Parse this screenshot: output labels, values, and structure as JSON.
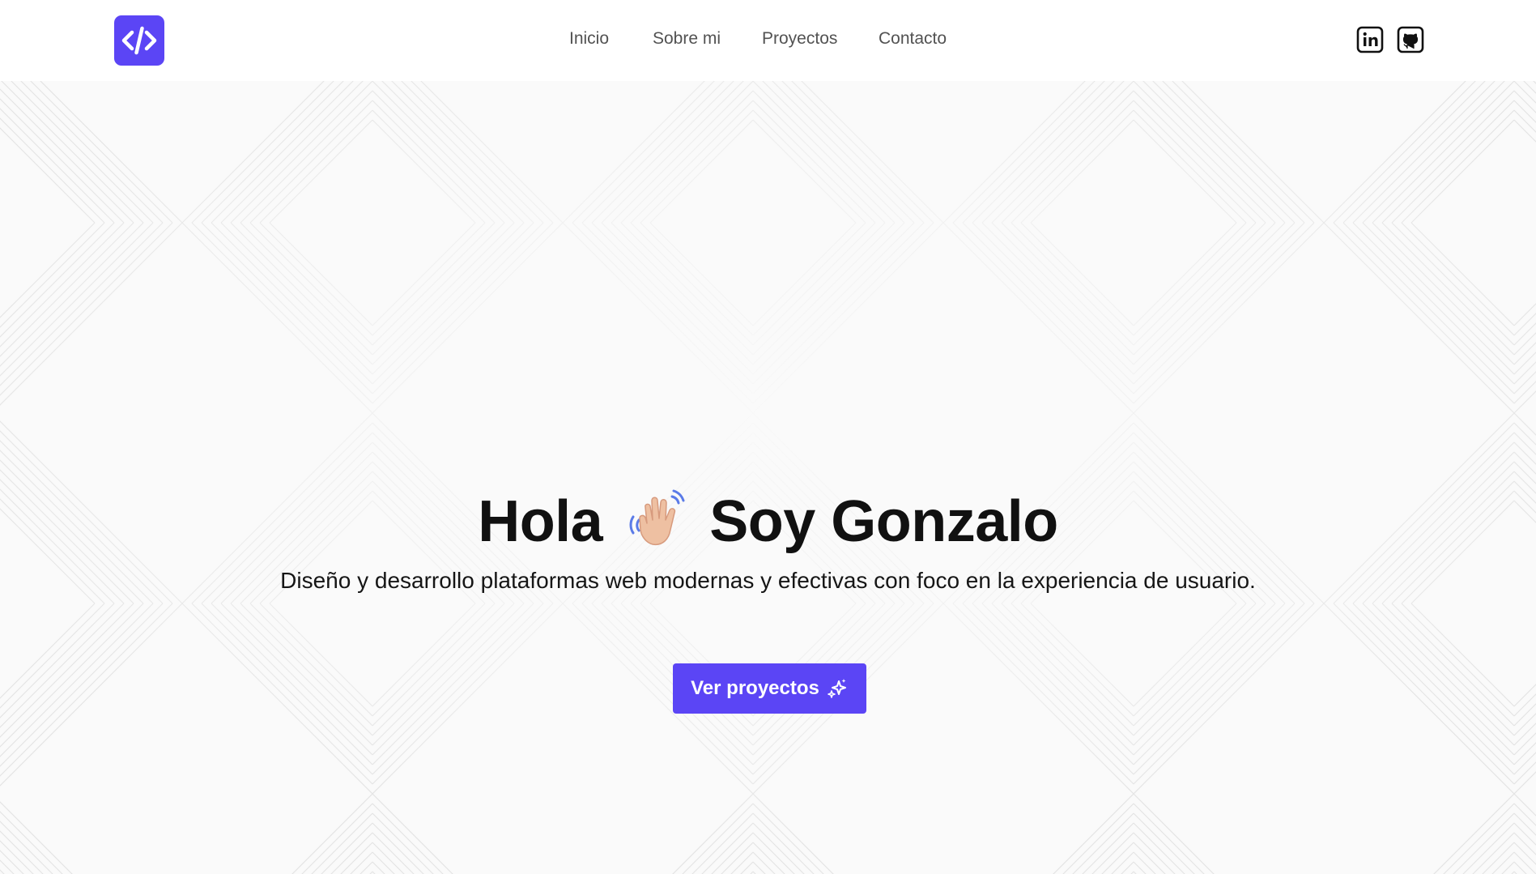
{
  "header": {
    "logo": {
      "icon": "code-brackets-icon",
      "color": "#5b45f5"
    },
    "nav": [
      {
        "label": "Inicio"
      },
      {
        "label": "Sobre mi"
      },
      {
        "label": "Proyectos"
      },
      {
        "label": "Contacto"
      }
    ],
    "social": [
      {
        "icon": "linkedin-icon"
      },
      {
        "icon": "github-icon"
      }
    ]
  },
  "hero": {
    "greeting": "Hola",
    "greeting_icon": "waving-hand-icon",
    "name": "Soy Gonzalo",
    "subtitle": "Diseño y desarrollo plataformas web modernas y efectivas con foco en la experiencia de usuario.",
    "cta_label": "Ver proyectos",
    "cta_icon": "sparkles-icon"
  },
  "colors": {
    "accent": "#5b45f5",
    "background": "#fafafa",
    "header_bg": "#ffffff",
    "text": "#111111",
    "nav_text": "#525252"
  }
}
